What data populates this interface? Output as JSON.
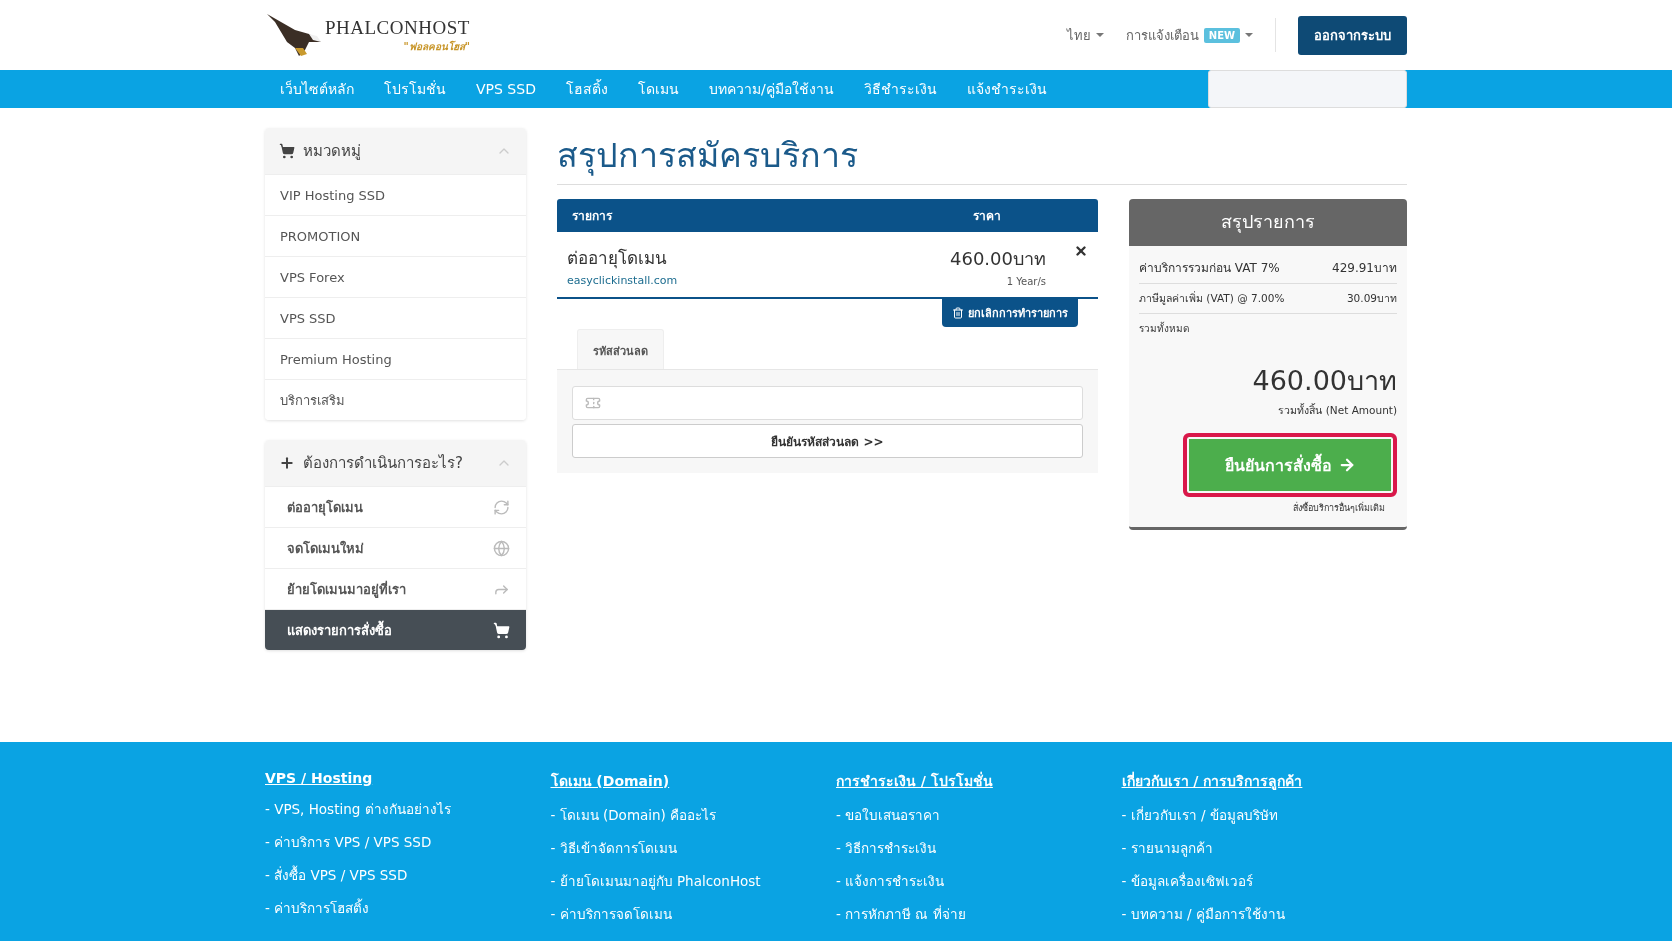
{
  "header": {
    "logo": {
      "name": "PHALCONHOST",
      "tagline": "\"ฟอลคอนโฮส\""
    },
    "language": "ไทย",
    "notifications": {
      "label": "การแจ้งเตือน",
      "badge": "NEW"
    },
    "logout": "ออกจากระบบ"
  },
  "nav": {
    "items": [
      "เว็บไซต์หลัก",
      "โปรโมชั่น",
      "VPS SSD",
      "โฮสติ้ง",
      "โดเมน",
      "บทความ/คู่มือใช้งาน",
      "วิธีชำระเงิน",
      "แจ้งชำระเงิน"
    ]
  },
  "sidebar": {
    "categories": {
      "title": "หมวดหมู่",
      "items": [
        "VIP Hosting SSD",
        "PROMOTION",
        "VPS Forex",
        "VPS SSD",
        "Premium Hosting",
        "บริการเสริม"
      ]
    },
    "actions": {
      "title": "ต้องการดำเนินการอะไร?",
      "items": [
        {
          "label": "ต่ออายุโดเมน",
          "selected": false
        },
        {
          "label": "จดโดเมนใหม่",
          "selected": false
        },
        {
          "label": "ย้ายโดเมนมาอยู่ที่เรา",
          "selected": false
        },
        {
          "label": "แสดงรายการสั่งซื้อ",
          "selected": true
        }
      ]
    }
  },
  "page_title": "สรุปการสมัครบริการ",
  "cart": {
    "columns": [
      "รายการ",
      "ราคา"
    ],
    "items": [
      {
        "name": "ต่ออายุโดเมน",
        "domain": "easyclickinstall.com",
        "price": "460.00บาท",
        "cycle": "1 Year/s"
      }
    ],
    "empty_cart": "ยกเลิกการทำรายการ",
    "promo_tab": "รหัสส่วนลด",
    "validate_button": "ยืนยันรหัสส่วนลด >>"
  },
  "summary": {
    "title": "สรุปรายการ",
    "rows": [
      {
        "label": "ค่าบริการรวมก่อน VAT 7%",
        "value": "429.91บาท",
        "kind": "large"
      },
      {
        "label": "ภาษีมูลค่าเพิ่ม (VAT) @ 7.00%",
        "value": "30.09บาท",
        "kind": "small"
      }
    ],
    "total_label": "รวมทั้งหมด",
    "total": "460.00บาท",
    "net_label": "รวมทั้งสิ้น (Net Amount)",
    "checkout": {
      "label": "ยืนยันการสั่งซื้อ",
      "focused": true
    },
    "continue": "สั่งซื้อบริการอื่นๆเพิ่มเติม"
  },
  "footer": {
    "columns": [
      {
        "heading": "VPS / Hosting",
        "links": [
          "- VPS, Hosting ต่างกันอย่างไร",
          "- ค่าบริการ VPS / VPS SSD",
          "- สั่งซื้อ VPS / VPS SSD",
          "- ค่าบริการโฮสติ้ง"
        ]
      },
      {
        "heading": "โดเมน (Domain)",
        "links": [
          "- โดเมน (Domain) คืออะไร",
          "- วิธีเข้าจัดการโดเมน",
          "- ย้ายโดเมนมาอยู่กับ PhalconHost",
          "- ค่าบริการจดโดเมน"
        ]
      },
      {
        "heading": "การชำระเงิน / โปรโมชั่น",
        "links": [
          "- ขอใบเสนอราคา",
          "- วิธีการชำระเงิน",
          "- แจ้งการชำระเงิน",
          "- การหักภาษี ณ ที่จ่าย"
        ]
      },
      {
        "heading": "เกี่ยวกับเรา / การบริการลูกค้า",
        "links": [
          "- เกี่ยวกับเรา / ข้อมูลบริษัท",
          "- รายนามลูกค้า",
          "- ข้อมูลเครื่องเซิฟเวอร์",
          "- บทความ / คู่มือการใช้งาน"
        ]
      }
    ]
  }
}
